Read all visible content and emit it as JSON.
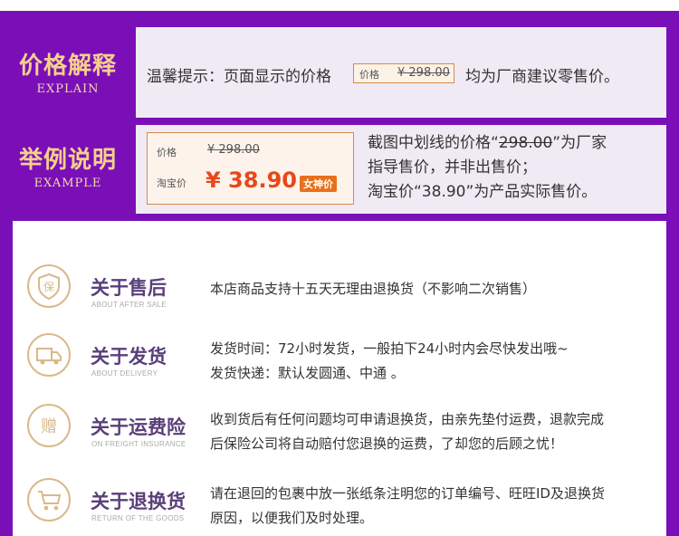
{
  "explain": {
    "title": "价格解释",
    "subtitle": "EXPLAIN",
    "notice_prefix": "温馨提示：页面显示的价格",
    "tag_label": "价格",
    "tag_price": "¥ 298.00",
    "notice_suffix": "均为厂商建议零售价。"
  },
  "example": {
    "title": "举例说明",
    "subtitle": "EXAMPLE",
    "price_label": "价格",
    "old_price": "¥ 298.00",
    "tb_label": "淘宝价",
    "new_price": "¥ 38.90",
    "badge": "女神价",
    "line1_a": "截图中划线的价格“",
    "line1_strike": "298.00",
    "line1_b": "”为厂家",
    "line2": "指导售价，并非出售价；",
    "line3": "淘宝价“38.90”为产品实际售价。"
  },
  "services": [
    {
      "icon": "shield-bao-icon",
      "title": "关于售后",
      "subtitle": "ABOUT AFTER SALE",
      "lines": [
        "本店商品支持十五天无理由退换货（不影响二次销售）"
      ]
    },
    {
      "icon": "delivery-truck-icon",
      "title": "关于发货",
      "subtitle": "ABOUT DELIVERY",
      "lines": [
        "发货时间：72小时发货，一般拍下24小时内会尽快发出哦~",
        "发货快递：默认发圆通、中通 。"
      ]
    },
    {
      "icon": "zeng-gift-icon",
      "title": "关于运费险",
      "subtitle": "ON FREIGHT INSURANCE",
      "lines": [
        "收到货后有任何问题均可申请退换货，由亲先垫付运费，退款完成",
        "后保险公司将自动赔付您退换的运费，了却您的后顾之忧！"
      ]
    },
    {
      "icon": "shopping-cart-icon",
      "title": "关于退换货",
      "subtitle": "RETURN OF THE GOODS",
      "lines": [
        "请在退回的包裹中放一张纸条注明您的订单编号、旺旺ID及退换货",
        "原因，以便我们及时处理。"
      ]
    }
  ],
  "colors": {
    "purple": "#7a0fb8",
    "gold": "#f4d08a",
    "price_red": "#e8471c",
    "title_purple": "#5a3f7a"
  }
}
